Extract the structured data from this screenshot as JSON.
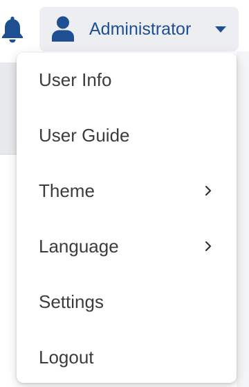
{
  "header": {
    "user_name": "Administrator",
    "accent_color": "#1f4f93",
    "icons": [
      "bell-icon",
      "user-icon",
      "caret-down-icon"
    ]
  },
  "menu": {
    "items": [
      {
        "label": "User Info",
        "has_submenu": false
      },
      {
        "label": "User Guide",
        "has_submenu": false
      },
      {
        "label": "Theme",
        "has_submenu": true
      },
      {
        "label": "Language",
        "has_submenu": true
      },
      {
        "label": "Settings",
        "has_submenu": false
      },
      {
        "label": "Logout",
        "has_submenu": false
      }
    ]
  }
}
